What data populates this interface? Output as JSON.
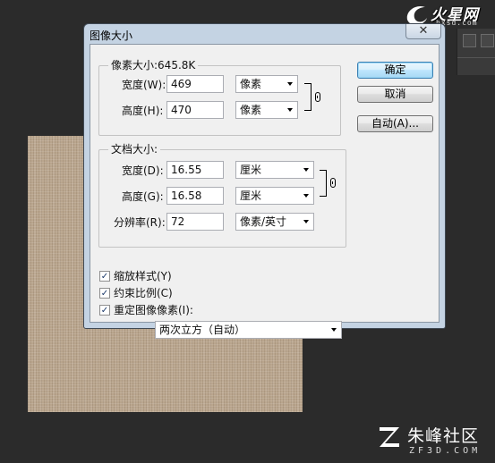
{
  "branding": {
    "logo_text": "火星网",
    "logo_sub": "hxsd.com",
    "watermark_cn": "朱峰社区",
    "watermark_en": "ZF3D.COM"
  },
  "dialog": {
    "title": "图像大小",
    "close_glyph": "✕",
    "buttons": {
      "ok": "确定",
      "cancel": "取消",
      "auto": "自动(A)..."
    },
    "pixel_dimensions": {
      "title": "像素大小:645.8K",
      "width_label": "宽度(W):",
      "width_value": "469",
      "width_unit": "像素",
      "height_label": "高度(H):",
      "height_value": "470",
      "height_unit": "像素"
    },
    "document_size": {
      "title": "文档大小:",
      "width_label": "宽度(D):",
      "width_value": "16.55",
      "width_unit": "厘米",
      "height_label": "高度(G):",
      "height_value": "16.58",
      "height_unit": "厘米",
      "resolution_label": "分辨率(R):",
      "resolution_value": "72",
      "resolution_unit": "像素/英寸"
    },
    "options": {
      "scale_styles": "缩放样式(Y)",
      "constrain_proportions": "约束比例(C)",
      "resample_image": "重定图像像素(I):",
      "scale_styles_checked": true,
      "constrain_checked": true,
      "resample_checked": true,
      "resample_method": "两次立方（自动）",
      "check_glyph": "✓"
    }
  },
  "colors": {
    "workspace_bg": "#2b2b2b",
    "dialog_frame": "#c4d3e3",
    "dialog_client": "#f0f0f0",
    "fabric": "#b9a58d",
    "default_button": "#bee6fd"
  }
}
